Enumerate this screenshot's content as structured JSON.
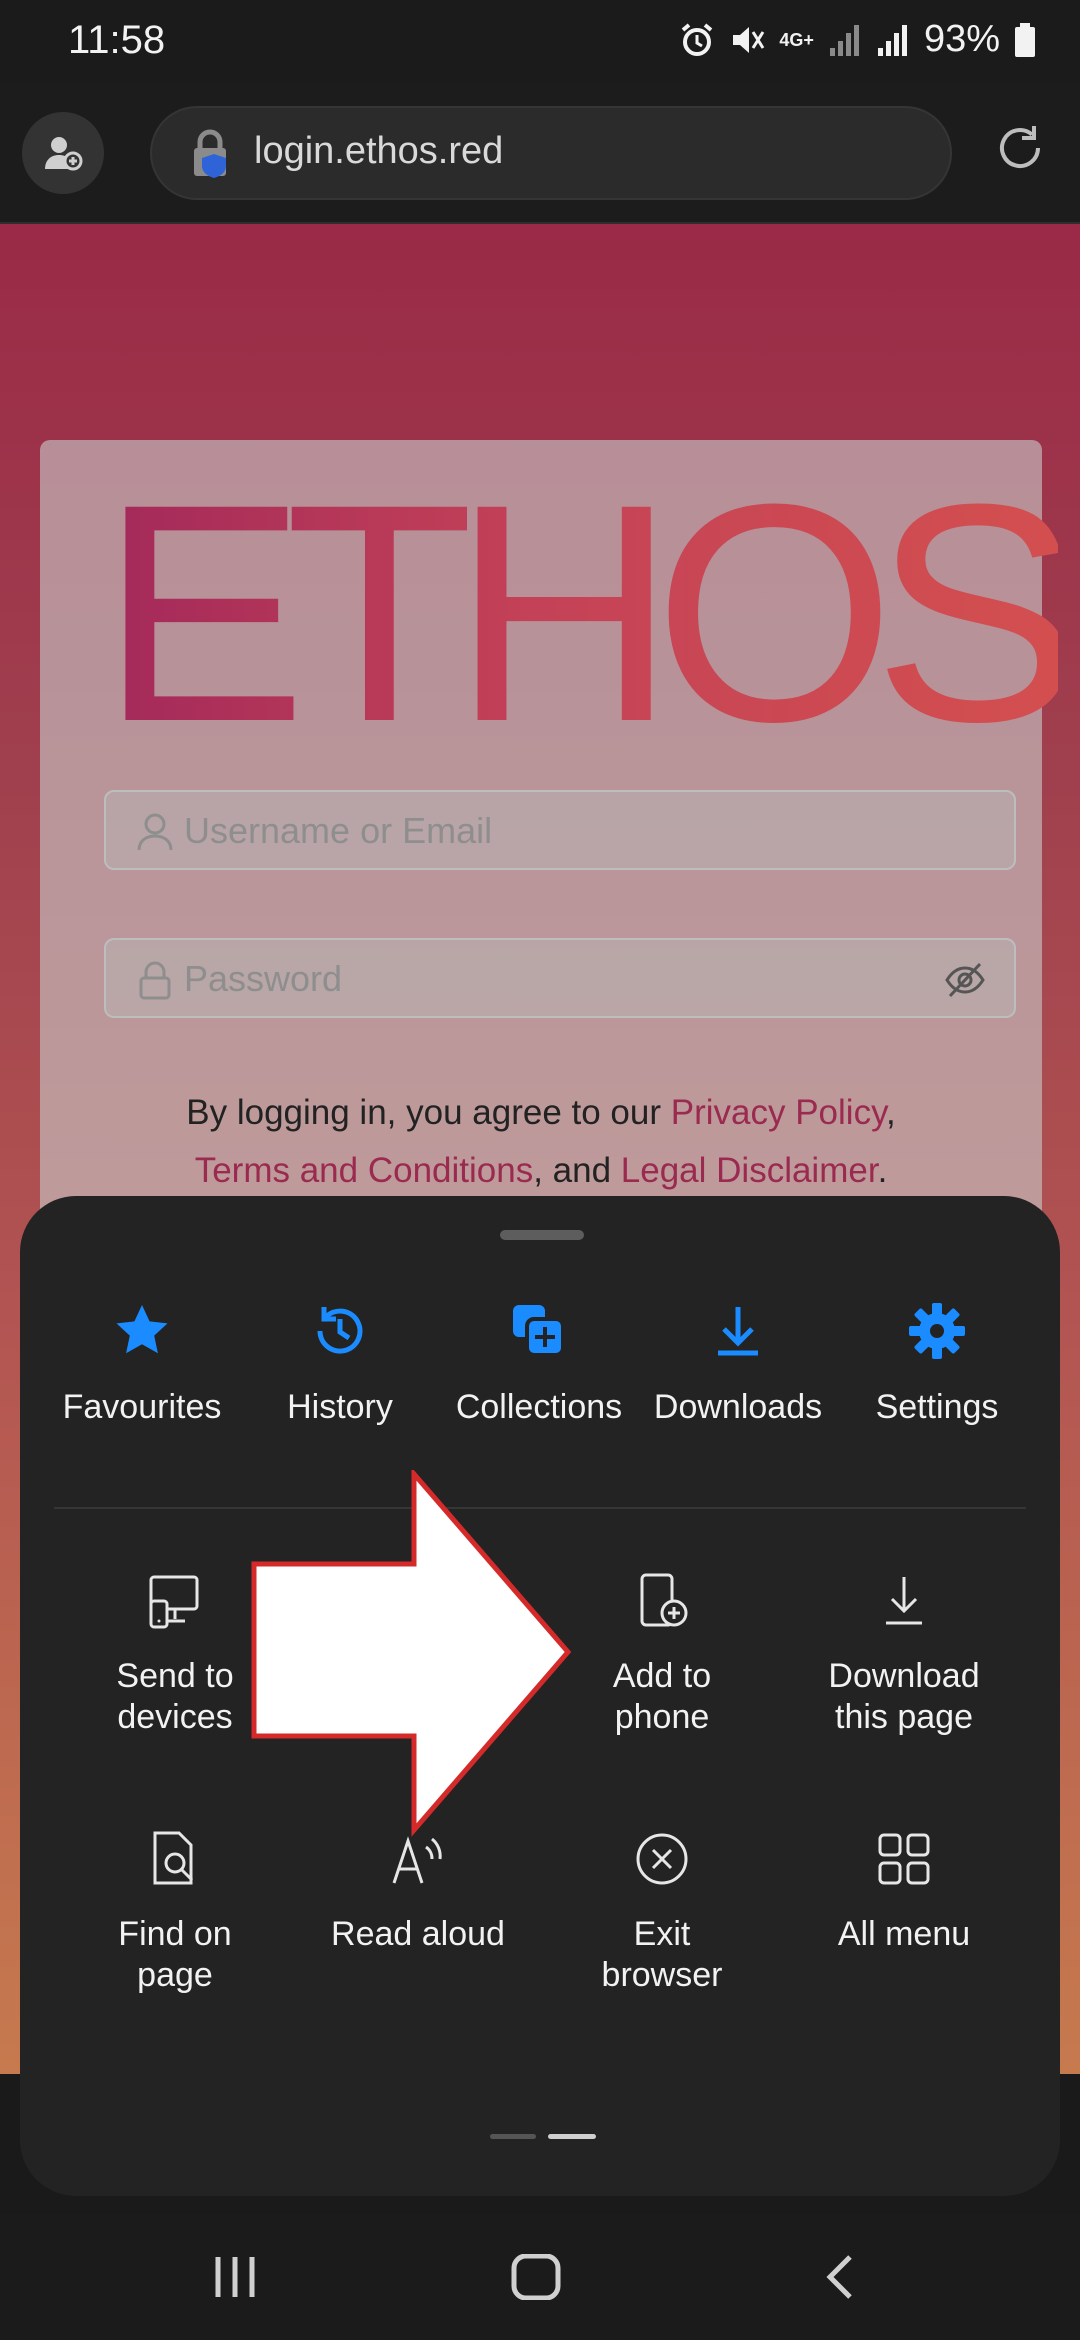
{
  "status_bar": {
    "time": "11:58",
    "network": "4G+",
    "battery": "93%"
  },
  "browser": {
    "url": "login.ethos.red"
  },
  "page": {
    "logo": "ETHOS",
    "username_placeholder": "Username or Email",
    "password_placeholder": "Password",
    "agree_prefix": "By logging in, you agree to our ",
    "privacy_link": "Privacy Policy",
    "comma": ",",
    "terms_link": "Terms and Conditions",
    "and_text": ", and ",
    "disclaimer_link": "Legal Disclaimer",
    "period": "."
  },
  "menu": {
    "quick_actions": [
      {
        "label": "Favourites",
        "icon": "star-icon"
      },
      {
        "label": "History",
        "icon": "history-icon"
      },
      {
        "label": "Collections",
        "icon": "collections-icon"
      },
      {
        "label": "Downloads",
        "icon": "download-icon"
      },
      {
        "label": "Settings",
        "icon": "gear-icon"
      }
    ],
    "tiles": [
      {
        "line1": "Send to",
        "line2": "devices",
        "icon": "send-to-devices-icon"
      },
      {
        "line1": "Add to",
        "line2": "phone",
        "icon": "add-to-phone-icon"
      },
      {
        "line1": "Download",
        "line2": "this page",
        "icon": "download-page-icon"
      },
      {
        "line1": "Find on",
        "line2": "page",
        "icon": "find-on-page-icon"
      },
      {
        "line1": "Read aloud",
        "line2": "",
        "icon": "read-aloud-icon"
      },
      {
        "line1": "Exit",
        "line2": "browser",
        "icon": "exit-icon"
      },
      {
        "line1": "All menu",
        "line2": "",
        "icon": "all-menu-icon"
      }
    ]
  },
  "colors": {
    "accent_blue": "#1a8cff",
    "sheet_bg": "#232323",
    "arrow_outline": "#d42a2a"
  }
}
